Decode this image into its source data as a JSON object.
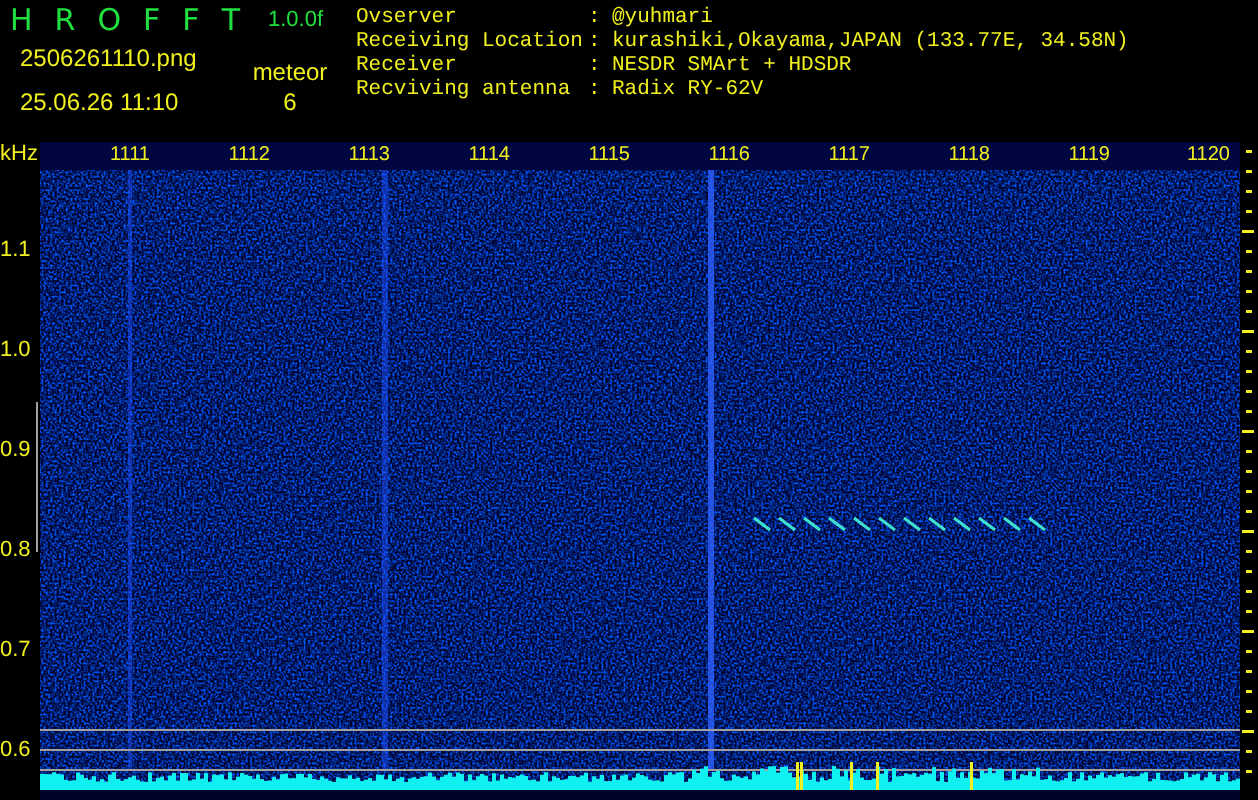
{
  "app": {
    "title_letters": [
      "H",
      "R",
      "O",
      "F",
      "F",
      "T"
    ],
    "version": "1.0.0f"
  },
  "file": {
    "name": "2506261110.png",
    "datetime": "25.06.26 11:10"
  },
  "detection": {
    "label": "meteor",
    "count": "6"
  },
  "info": [
    {
      "label": "Ovserver",
      "separator": ":",
      "value": "@yuhmari"
    },
    {
      "label": "Receiving Location",
      "separator": ":",
      "value": "kurashiki,Okayama,JAPAN (133.77E, 34.58N)"
    },
    {
      "label": "Receiver",
      "separator": ":",
      "value": "NESDR SMArt + HDSDR"
    },
    {
      "label": "Recviving antenna",
      "separator": ":",
      "value": "Radix RY-62V"
    }
  ],
  "plot": {
    "unit": "kHz",
    "x_labels": [
      "1111",
      "1112",
      "1113",
      "1114",
      "1115",
      "1116",
      "1117",
      "1118",
      "1119",
      "1120"
    ],
    "y_labels": [
      "1.1",
      "1.0",
      "0.9",
      "0.8",
      "0.7",
      "0.6"
    ]
  }
}
